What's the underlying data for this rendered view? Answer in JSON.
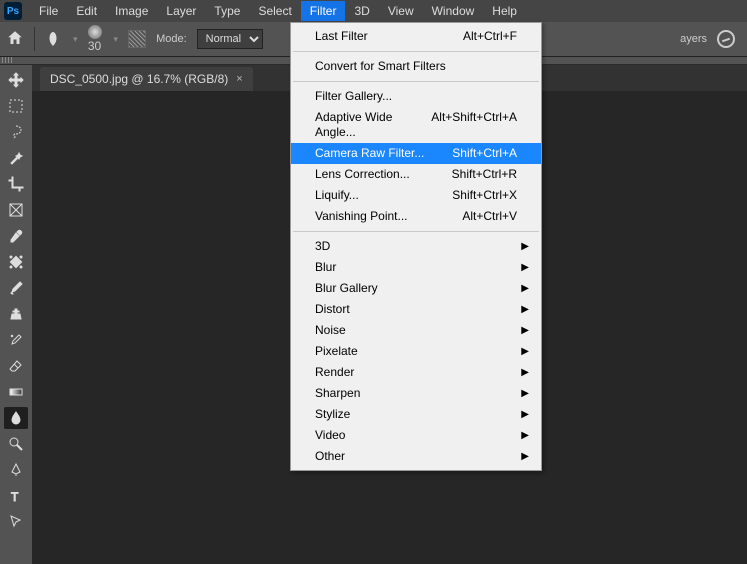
{
  "menubar": {
    "items": [
      "File",
      "Edit",
      "Image",
      "Layer",
      "Type",
      "Select",
      "Filter",
      "3D",
      "View",
      "Window",
      "Help"
    ],
    "active_index": 6
  },
  "optionbar": {
    "brush_size": "30",
    "mode_label": "Mode:",
    "mode_value": "Normal",
    "layers_label": "ayers"
  },
  "tab": {
    "title": "DSC_0500.jpg @ 16.7% (RGB/8)"
  },
  "dropdown": {
    "section1": [
      {
        "label": "Last Filter",
        "shortcut": "Alt+Ctrl+F"
      }
    ],
    "section2": [
      {
        "label": "Convert for Smart Filters",
        "shortcut": ""
      }
    ],
    "section3": [
      {
        "label": "Filter Gallery...",
        "shortcut": ""
      },
      {
        "label": "Adaptive Wide Angle...",
        "shortcut": "Alt+Shift+Ctrl+A"
      },
      {
        "label": "Camera Raw Filter...",
        "shortcut": "Shift+Ctrl+A",
        "highlight": true
      },
      {
        "label": "Lens Correction...",
        "shortcut": "Shift+Ctrl+R"
      },
      {
        "label": "Liquify...",
        "shortcut": "Shift+Ctrl+X"
      },
      {
        "label": "Vanishing Point...",
        "shortcut": "Alt+Ctrl+V"
      }
    ],
    "section4": [
      {
        "label": "3D",
        "submenu": true
      },
      {
        "label": "Blur",
        "submenu": true
      },
      {
        "label": "Blur Gallery",
        "submenu": true
      },
      {
        "label": "Distort",
        "submenu": true
      },
      {
        "label": "Noise",
        "submenu": true
      },
      {
        "label": "Pixelate",
        "submenu": true
      },
      {
        "label": "Render",
        "submenu": true
      },
      {
        "label": "Sharpen",
        "submenu": true
      },
      {
        "label": "Stylize",
        "submenu": true
      },
      {
        "label": "Video",
        "submenu": true
      },
      {
        "label": "Other",
        "submenu": true
      }
    ]
  }
}
